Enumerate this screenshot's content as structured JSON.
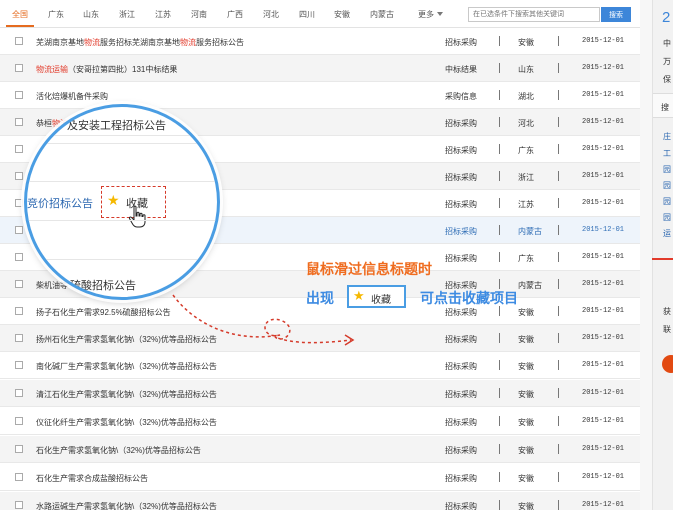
{
  "tabs": [
    "全国",
    "广东",
    "山东",
    "浙江",
    "江苏",
    "河南",
    "广西",
    "河北",
    "四川",
    "安徽",
    "内蒙古"
  ],
  "more_label": "更多",
  "search": {
    "placeholder": "在已选条件下搜索其他关键词",
    "button": "搜索"
  },
  "rows": [
    {
      "title_pre": "芜湖南京基地",
      "title_hl": "物流",
      "title_mid": "服务招标芜湖南京基地",
      "title_hl2": "物流",
      "title_post": "服务招标公告",
      "category": "招标采购",
      "province": "安徽",
      "date": "2015-12-01"
    },
    {
      "title_pre": "",
      "title_hl": "物流运输",
      "title_mid": "（安哥拉第四批）131中标结果",
      "title_hl2": "",
      "title_post": "",
      "category": "中标结果",
      "province": "山东",
      "date": "2015-12-01"
    },
    {
      "title_pre": "活化焙爆机备件采购",
      "title_hl": "",
      "title_mid": "",
      "title_hl2": "",
      "title_post": "",
      "category": "采购信息",
      "province": "湖北",
      "date": "2015-12-01"
    },
    {
      "title_pre": "恭桓",
      "title_hl": "物流",
      "title_mid": "",
      "title_hl2": "",
      "title_post": "",
      "category": "招标采购",
      "province": "河北",
      "date": "2015-12-01"
    },
    {
      "title_pre": "",
      "title_hl": "",
      "title_mid": "",
      "title_hl2": "",
      "title_post": "",
      "category": "招标采购",
      "province": "广东",
      "date": "2015-12-01"
    },
    {
      "title_pre": "",
      "title_hl": "",
      "title_mid": "",
      "title_hl2": "",
      "title_post": "",
      "category": "招标采购",
      "province": "浙江",
      "date": "2015-12-01"
    },
    {
      "title_pre": "",
      "title_hl": "",
      "title_mid": "",
      "title_hl2": "",
      "title_post": "",
      "category": "招标采购",
      "province": "江苏",
      "date": "2015-12-01"
    },
    {
      "title_pre": "",
      "title_hl": "",
      "title_mid": "",
      "title_hl2": "",
      "title_post": "",
      "category": "招标采购",
      "province": "内蒙古",
      "date": "2015-12-01"
    },
    {
      "title_pre": "",
      "title_hl": "",
      "title_mid": "",
      "title_hl2": "",
      "title_post": "",
      "category": "招标采购",
      "province": "广东",
      "date": "2015-12-01"
    },
    {
      "title_pre": "柴机油等",
      "title_hl": "",
      "title_mid": "",
      "title_hl2": "",
      "title_post": "",
      "category": "招标采购",
      "province": "内蒙古",
      "date": "2015-12-01"
    },
    {
      "title_pre": "扬子石化生产需求92.5%硫酸招标公告",
      "title_hl": "",
      "title_mid": "",
      "title_hl2": "",
      "title_post": "",
      "category": "招标采购",
      "province": "安徽",
      "date": "2015-12-01"
    },
    {
      "title_pre": "扬州石化生产需求氢氧化钠\\（32%)优等品招标公告",
      "title_hl": "",
      "title_mid": "",
      "title_hl2": "",
      "title_post": "",
      "category": "招标采购",
      "province": "安徽",
      "date": "2015-12-01"
    },
    {
      "title_pre": "南化碱厂生产需求氢氧化钠\\（32%)优等品招标公告",
      "title_hl": "",
      "title_mid": "",
      "title_hl2": "",
      "title_post": "",
      "category": "招标采购",
      "province": "安徽",
      "date": "2015-12-01"
    },
    {
      "title_pre": "清江石化生产需求氢氧化钠\\（32%)优等品招标公告",
      "title_hl": "",
      "title_mid": "",
      "title_hl2": "",
      "title_post": "",
      "category": "招标采购",
      "province": "安徽",
      "date": "2015-12-01"
    },
    {
      "title_pre": "仪征化纤生产需求氢氧化钠\\（32%)优等品招标公告",
      "title_hl": "",
      "title_mid": "",
      "title_hl2": "",
      "title_post": "",
      "category": "招标采购",
      "province": "安徽",
      "date": "2015-12-01"
    },
    {
      "title_pre": "石化生产需求氢氧化钠\\（32%)优等品招标公告",
      "title_hl": "",
      "title_mid": "",
      "title_hl2": "",
      "title_post": "",
      "category": "招标采购",
      "province": "安徽",
      "date": "2015-12-01"
    },
    {
      "title_pre": "石化生产需求合成盐酸招标公告",
      "title_hl": "",
      "title_mid": "",
      "title_hl2": "",
      "title_post": "",
      "category": "招标采购",
      "province": "安徽",
      "date": "2015-12-01"
    },
    {
      "title_pre": "水路运碱生产需求氢氧化钠\\（32%)优等品招标公告",
      "title_hl": "",
      "title_mid": "",
      "title_hl2": "",
      "title_post": "",
      "category": "招标采购",
      "province": "安徽",
      "date": "2015-12-01"
    }
  ],
  "magnifier": {
    "line1_pre": "",
    "line1_hl": "",
    "line1_post": "及安装工程招标公告",
    "link": "竞价招标公告",
    "fav_label": "收藏",
    "line_bottom": "硫酸招标公告"
  },
  "annotation": {
    "line1": "鼠标滑过信息标题时",
    "line2_pre": "出现",
    "fav_label": "收藏",
    "line2_post": "可点击收藏项目"
  },
  "right_panel": {
    "big": "2",
    "texts": [
      "中",
      "万",
      "保"
    ],
    "heading": "搜",
    "links": [
      "庄",
      "工",
      "园",
      "园",
      "园",
      "园",
      "运"
    ],
    "texts2": [
      "获",
      "联"
    ]
  },
  "colors": {
    "accent": "#e56b1f",
    "link": "#2b67b0",
    "highlight": "#e23a2a",
    "annotation_orange": "#ef6c1f",
    "annotation_blue": "#3d8be2",
    "search_button": "#3d86d9"
  },
  "icons": {
    "checkbox": "checkbox-icon",
    "star": "star-icon",
    "cursor": "hand-cursor-icon"
  }
}
